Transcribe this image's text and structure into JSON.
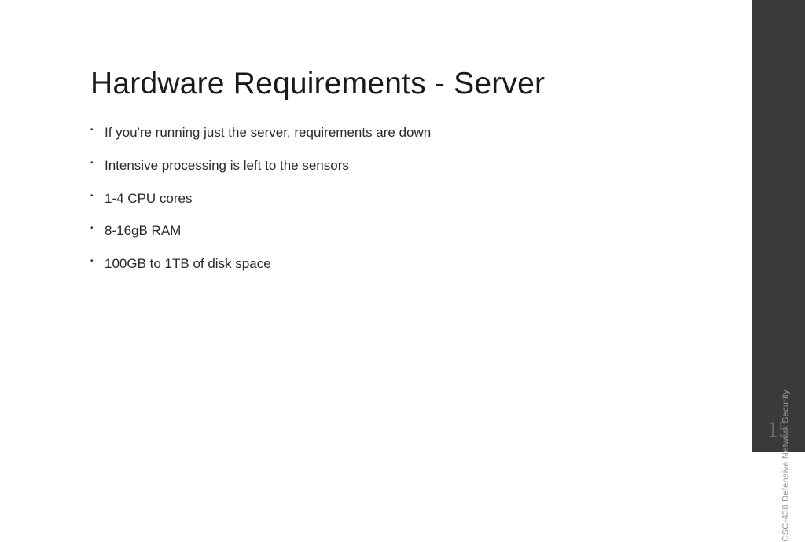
{
  "slide": {
    "title": "Hardware Requirements - Server",
    "bullets": [
      "If you're running just the server, requirements are down",
      "Intensive processing is left to the sensors",
      "1-4 CPU cores",
      "8-16gB RAM",
      "100GB to 1TB of disk space"
    ]
  },
  "sidebar": {
    "course_label": "CSC-438 Defensive Network Security",
    "page_number": "15"
  }
}
